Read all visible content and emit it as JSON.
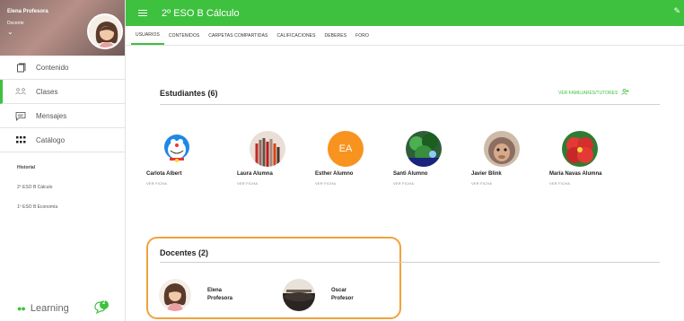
{
  "sidebar": {
    "user_name": "Elena Profesora",
    "user_role": "Docente",
    "menu": [
      {
        "label": "Contenido",
        "icon": "content-icon"
      },
      {
        "label": "Clases",
        "icon": "classes-icon"
      },
      {
        "label": "Mensajes",
        "icon": "messages-icon"
      },
      {
        "label": "Catálogo",
        "icon": "catalog-icon"
      }
    ],
    "history_title": "Historial",
    "history": [
      "2º ESO B Cálculo",
      "1º ESO B Economía"
    ],
    "brand": "Learning",
    "chat_badge": "2"
  },
  "header": {
    "title": "2º ESO B Cálculo",
    "tabs": [
      "USUARIOS",
      "CONTENIDOS",
      "CARPETAS COMPARTIDAS",
      "CALIFICACIONES",
      "DEBERES",
      "FORO"
    ],
    "active_tab": "USUARIOS"
  },
  "students": {
    "title": "Estudiantes (6)",
    "family_link": "VER FAMILIARES/TUTORES",
    "items": [
      {
        "name": "Carlota Albert",
        "action": "VER FICHA"
      },
      {
        "name": "Laura Alumna",
        "action": "VER FICHA"
      },
      {
        "name": "Esther Alumno",
        "action": "VER FICHA",
        "initials": "EA"
      },
      {
        "name": "Santi Alumno",
        "action": "VER FICHA"
      },
      {
        "name": "Javier Blink",
        "action": "VER FICHA"
      },
      {
        "name": "María Navas Alumna",
        "action": "VER FICHA"
      }
    ]
  },
  "teachers": {
    "title": "Docentes (2)",
    "items": [
      {
        "first": "Elena",
        "last": "Profesora"
      },
      {
        "first": "Oscar",
        "last": "Profesor"
      }
    ]
  },
  "colors": {
    "accent": "#3ec13e",
    "highlight": "#f2a23a",
    "initials_bg": "#f7931e"
  }
}
